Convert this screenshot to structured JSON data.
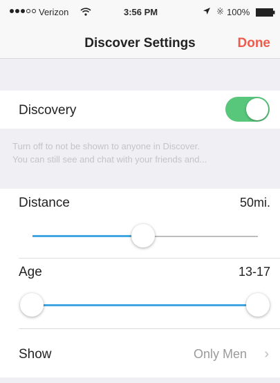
{
  "status_bar": {
    "carrier": "Verizon",
    "time": "3:56 PM",
    "battery": "100%",
    "signal_icon": "signal-dots-icon",
    "wifi_icon": "wifi-icon",
    "location_icon": "location-arrow-icon",
    "bluetooth_icon": "bluetooth-icon",
    "battery_icon": "battery-full-icon"
  },
  "nav": {
    "title": "Discover Settings",
    "done_label": "Done",
    "accent_color": "#f05a4b"
  },
  "discovery": {
    "label": "Discovery",
    "enabled": true,
    "toggle_color": "#58c77b",
    "hint_line1": "Turn off to not be shown to anyone in Discover.",
    "hint_line2": "You can still see and chat with your friends and..."
  },
  "distance": {
    "label": "Distance",
    "value": "50mi.",
    "slider_fraction": 0.5
  },
  "age": {
    "label": "Age",
    "value": "13-17",
    "range_min_fraction": 0.0,
    "range_max_fraction": 1.0,
    "fill_color": "#3fa7e3"
  },
  "show": {
    "label": "Show",
    "value": "Only Men",
    "chevron_icon": "chevron-right-icon"
  }
}
